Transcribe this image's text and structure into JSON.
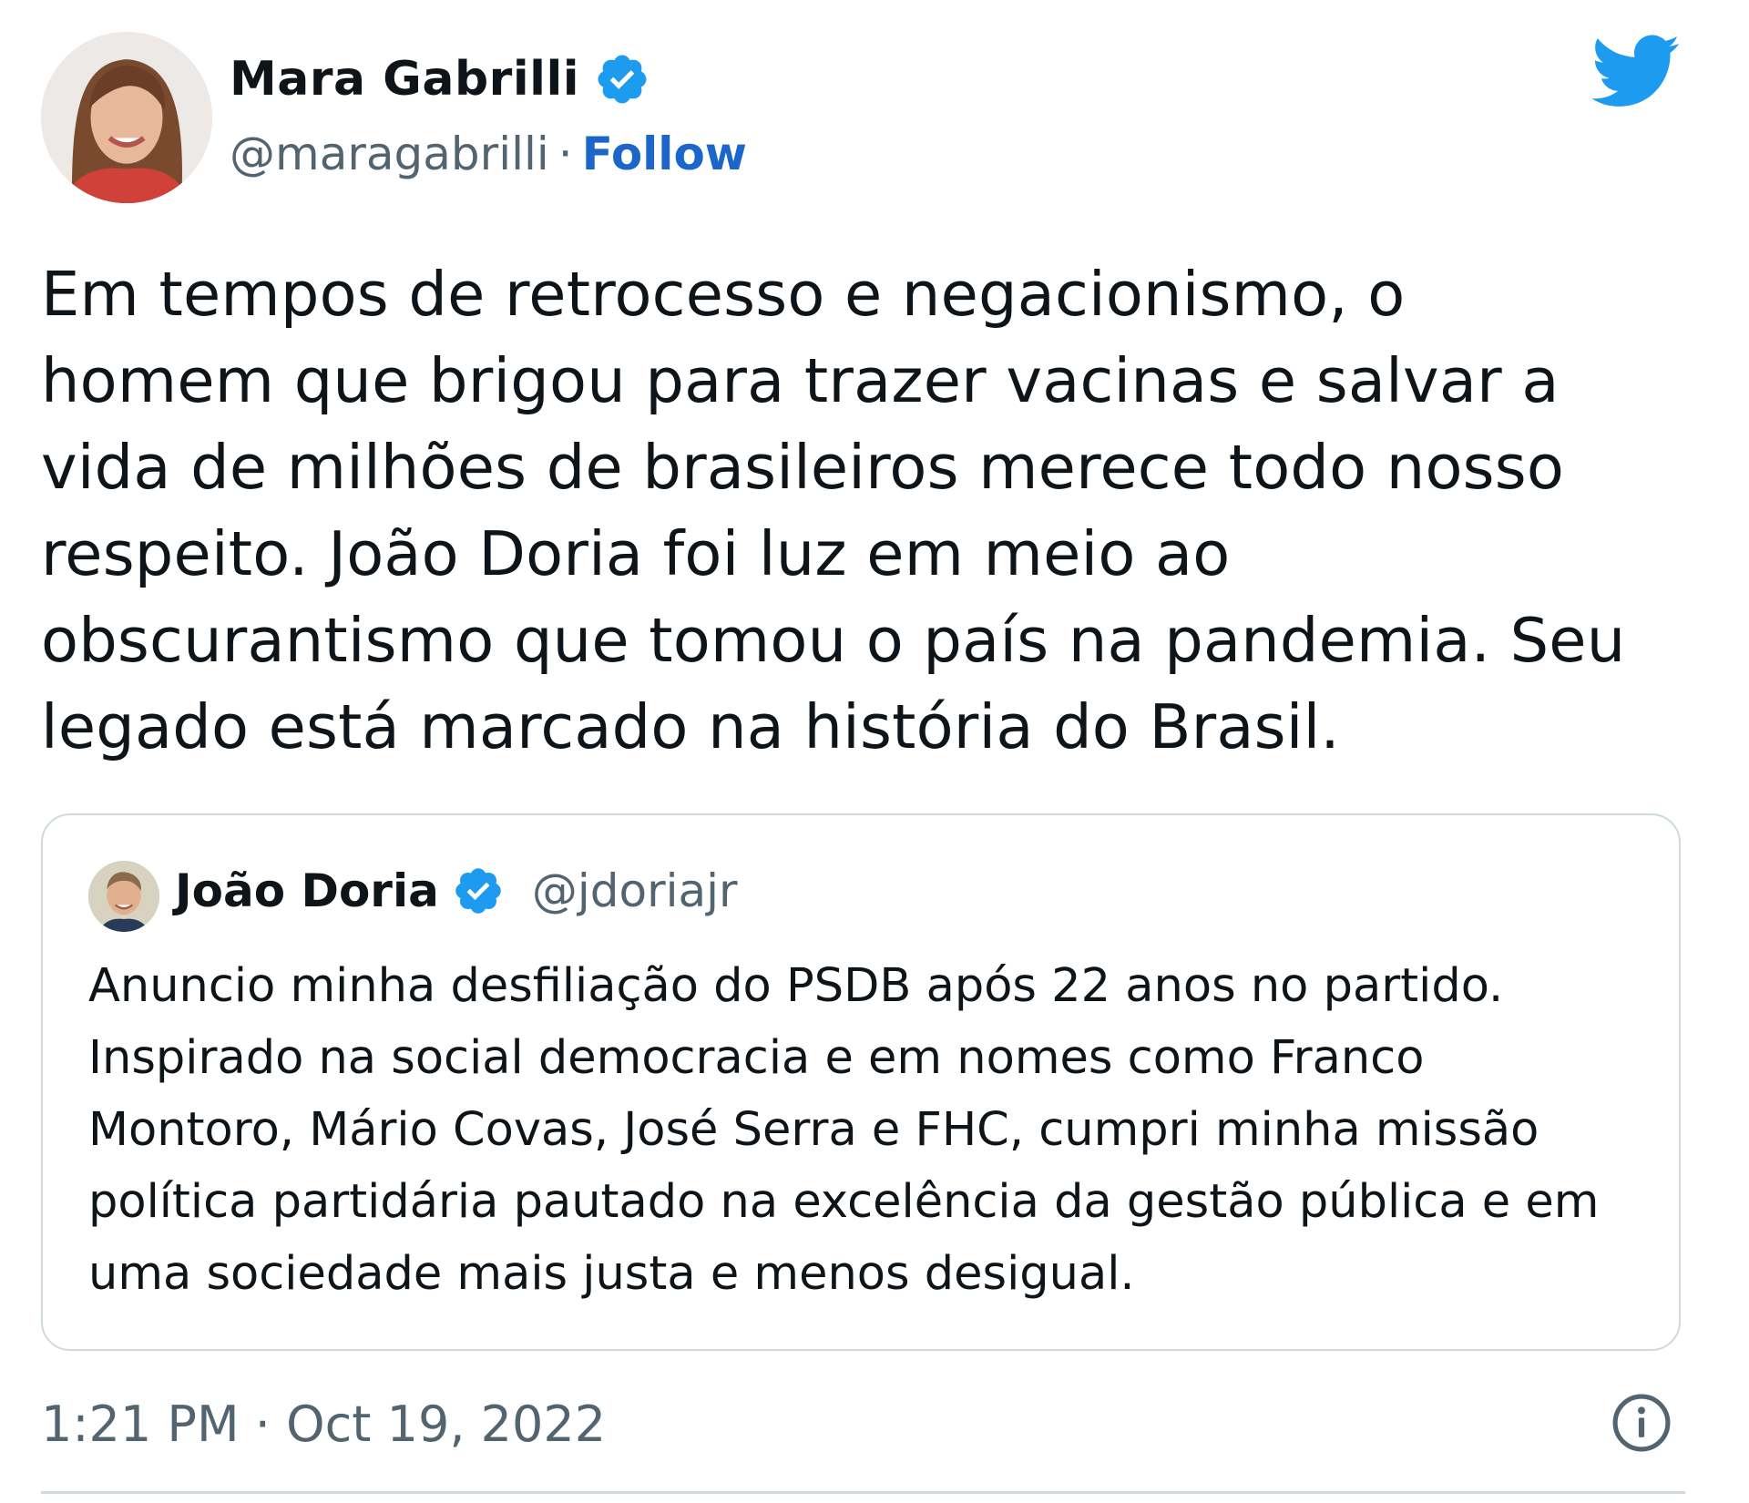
{
  "tweet": {
    "author": {
      "name": "Mara Gabrilli",
      "handle": "@maragabrilli",
      "separator": "·",
      "follow_label": "Follow",
      "avatar_icon": "profile-photo-avatar",
      "verified_icon": "verified-badge-icon"
    },
    "text": "Em tempos de retrocesso e negacionismo, o\nhomem que brigou para trazer vacinas e salvar a\nvida de milhões de brasileiros merece todo nosso\nrespeito. João Doria foi luz em meio ao\nobscurantismo que tomou o país na pandemia. Seu\nlegado está marcado na história do Brasil.",
    "quoted": {
      "name": "João Doria",
      "handle": "@jdoriajr",
      "text": "Anuncio minha desfiliação do PSDB após 22 anos no partido.\nInspirado na social democracia e em nomes como Franco\nMontoro, Mário Covas, José Serra e FHC, cumpri minha missão\npolítica partidária pautado na excelência da gestão pública e em\numa sociedade mais justa e menos desigual."
    },
    "timestamp": "1:21 PM · Oct 19, 2022",
    "icons": {
      "brand": "twitter-bird-icon",
      "info": "info-icon"
    },
    "colors": {
      "twitter_blue": "#1d9bf0",
      "follow_blue": "#1d66c9",
      "secondary_text": "#536471",
      "border": "#cfd9de"
    }
  }
}
